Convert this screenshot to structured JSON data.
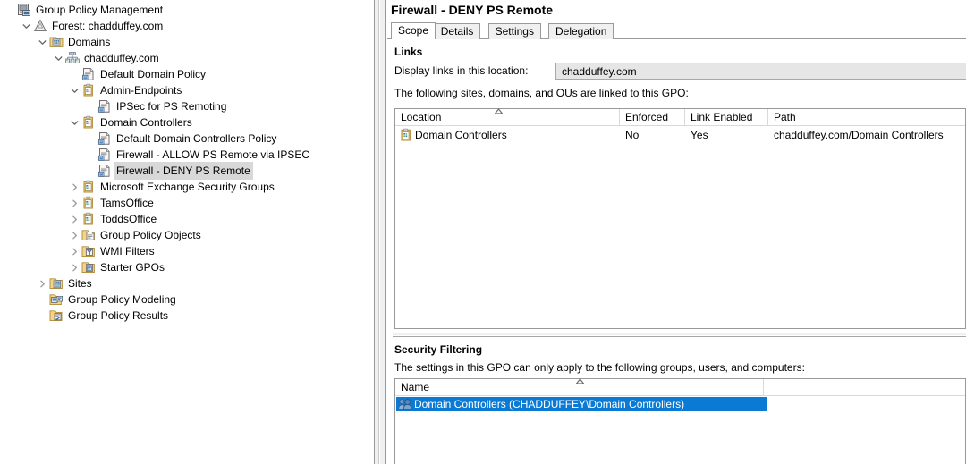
{
  "tree": {
    "items": [
      {
        "label": "Group Policy Management",
        "indent": 0,
        "chev": "none",
        "icon": "console-root-icon",
        "selected": false
      },
      {
        "label": "Forest: chadduffey.com",
        "indent": 1,
        "chev": "down",
        "icon": "forest-icon",
        "selected": false
      },
      {
        "label": "Domains",
        "indent": 2,
        "chev": "down",
        "icon": "domains-icon",
        "selected": false
      },
      {
        "label": "chadduffey.com",
        "indent": 3,
        "chev": "down",
        "icon": "domain-icon",
        "selected": false
      },
      {
        "label": "Default Domain Policy",
        "indent": 4,
        "chev": "none",
        "icon": "gpo-link-icon",
        "selected": false
      },
      {
        "label": "Admin-Endpoints",
        "indent": 4,
        "chev": "down",
        "icon": "ou-icon",
        "selected": false
      },
      {
        "label": "IPSec for PS Remoting",
        "indent": 5,
        "chev": "none",
        "icon": "gpo-link-icon",
        "selected": false
      },
      {
        "label": "Domain Controllers",
        "indent": 4,
        "chev": "down",
        "icon": "ou-icon",
        "selected": false
      },
      {
        "label": "Default Domain Controllers Policy",
        "indent": 5,
        "chev": "none",
        "icon": "gpo-link-icon",
        "selected": false
      },
      {
        "label": "Firewall - ALLOW PS Remote via IPSEC",
        "indent": 5,
        "chev": "none",
        "icon": "gpo-link-icon",
        "selected": false
      },
      {
        "label": "Firewall - DENY PS Remote",
        "indent": 5,
        "chev": "none",
        "icon": "gpo-link-icon",
        "selected": true
      },
      {
        "label": "Microsoft Exchange Security Groups",
        "indent": 4,
        "chev": "right",
        "icon": "ou-icon",
        "selected": false
      },
      {
        "label": "TamsOffice",
        "indent": 4,
        "chev": "right",
        "icon": "ou-icon",
        "selected": false
      },
      {
        "label": "ToddsOffice",
        "indent": 4,
        "chev": "right",
        "icon": "ou-icon",
        "selected": false
      },
      {
        "label": "Group Policy Objects",
        "indent": 4,
        "chev": "right",
        "icon": "gpo-folder-icon",
        "selected": false
      },
      {
        "label": "WMI Filters",
        "indent": 4,
        "chev": "right",
        "icon": "wmi-folder-icon",
        "selected": false
      },
      {
        "label": "Starter GPOs",
        "indent": 4,
        "chev": "right",
        "icon": "starter-folder-icon",
        "selected": false
      },
      {
        "label": "Sites",
        "indent": 2,
        "chev": "right",
        "icon": "sites-icon",
        "selected": false
      },
      {
        "label": "Group Policy Modeling",
        "indent": 2,
        "chev": "none",
        "icon": "modeling-icon",
        "selected": false
      },
      {
        "label": "Group Policy Results",
        "indent": 2,
        "chev": "none",
        "icon": "results-icon",
        "selected": false
      }
    ]
  },
  "detail": {
    "title": "Firewall - DENY PS Remote",
    "tabs": [
      {
        "label": "Scope",
        "active": true
      },
      {
        "label": "Details",
        "active": false
      },
      {
        "label": "Settings",
        "active": false
      },
      {
        "label": "Delegation",
        "active": false
      }
    ],
    "links": {
      "heading": "Links",
      "display_label": "Display links in this location:",
      "location_value": "chadduffey.com",
      "description": "The following sites, domains, and OUs are linked to this GPO:",
      "columns": [
        "Location",
        "Enforced",
        "Link Enabled",
        "Path"
      ],
      "sorted_column": "Location",
      "sort_direction": "ascending",
      "rows": [
        {
          "Location": "Domain Controllers",
          "Enforced": "No",
          "Link Enabled": "Yes",
          "Path": "chadduffey.com/Domain Controllers"
        }
      ]
    },
    "security_filtering": {
      "heading": "Security Filtering",
      "description": "The settings in this GPO can only apply to the following groups, users, and computers:",
      "columns": [
        "Name"
      ],
      "rows": [
        {
          "Name": "Domain Controllers (CHADDUFFEY\\Domain Controllers)",
          "selected": true
        }
      ]
    }
  },
  "colors": {
    "selection_blue": "#0b7ad4",
    "tree_inactive_selection": "#d8d8d8",
    "chrome_gray": "#f0f0f0",
    "border_gray": "#999999"
  }
}
